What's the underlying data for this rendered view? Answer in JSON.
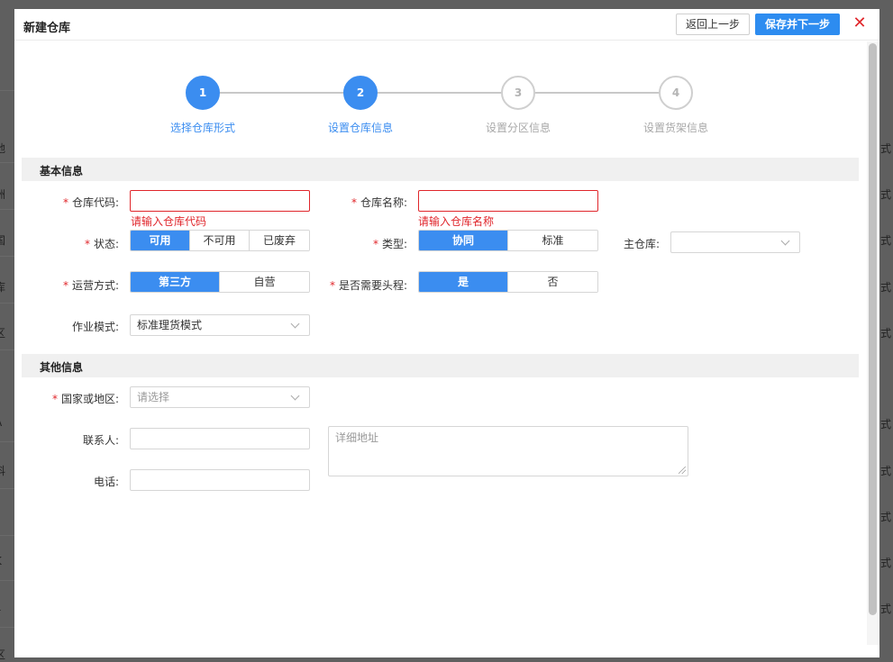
{
  "background": {
    "left_fragments": [
      "地",
      "洲",
      "国",
      "库",
      "区",
      "A",
      "科",
      "J",
      "K",
      "L",
      "区"
    ],
    "right_fragments": [
      "式",
      "式",
      "式",
      "式",
      "式",
      "式",
      "式",
      "式",
      "式",
      "式"
    ]
  },
  "header": {
    "title": "新建仓库",
    "back_label": "返回上一步",
    "save_label": "保存并下一步",
    "close_glyph": "✕"
  },
  "steps": [
    {
      "number": "1",
      "label": "选择仓库形式",
      "state": "active"
    },
    {
      "number": "2",
      "label": "设置仓库信息",
      "state": "active"
    },
    {
      "number": "3",
      "label": "设置分区信息",
      "state": "inactive"
    },
    {
      "number": "4",
      "label": "设置货架信息",
      "state": "inactive"
    }
  ],
  "basic": {
    "section_title": "基本信息",
    "code": {
      "label": "仓库代码:",
      "value": "",
      "error": "请输入仓库代码"
    },
    "name": {
      "label": "仓库名称:",
      "value": "",
      "error": "请输入仓库名称"
    },
    "status": {
      "label": "状态:",
      "options": [
        "可用",
        "不可用",
        "已废弃"
      ],
      "selected": "可用"
    },
    "type": {
      "label": "类型:",
      "options": [
        "协同",
        "标准"
      ],
      "selected": "协同"
    },
    "main_warehouse": {
      "label": "主仓库:",
      "value": ""
    },
    "operation": {
      "label": "运营方式:",
      "options": [
        "第三方",
        "自营"
      ],
      "selected": "第三方"
    },
    "first_leg": {
      "label": "是否需要头程:",
      "options": [
        "是",
        "否"
      ],
      "selected": "是"
    },
    "work_mode": {
      "label": "作业模式:",
      "value": "标准理货模式"
    }
  },
  "other": {
    "section_title": "其他信息",
    "country": {
      "label": "国家或地区:",
      "placeholder": "请选择"
    },
    "contact": {
      "label": "联系人:",
      "value": ""
    },
    "phone": {
      "label": "电话:",
      "value": ""
    },
    "address": {
      "placeholder": "详细地址"
    }
  },
  "colors": {
    "primary": "#3b8df0",
    "error": "#e0262b",
    "close": "#e0262b"
  }
}
